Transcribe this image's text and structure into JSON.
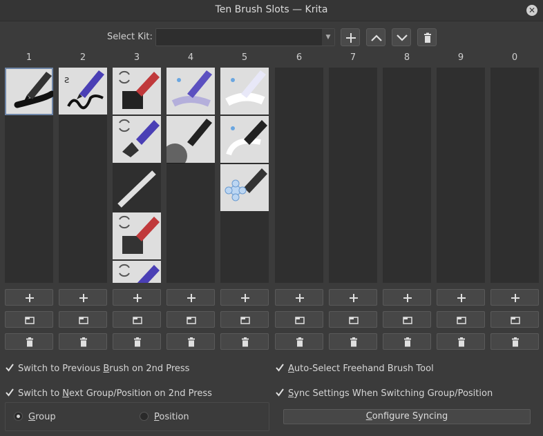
{
  "window": {
    "title": "Ten Brush Slots — Krita"
  },
  "kit": {
    "label": "Select Kit:",
    "value": ""
  },
  "columns": [
    {
      "number": "1",
      "tiles": [
        {
          "name": "pen-preset",
          "selected": true
        }
      ]
    },
    {
      "number": "2",
      "tiles": [
        {
          "name": "ink-pen-preset",
          "selected": false
        }
      ]
    },
    {
      "number": "3",
      "tiles": [
        {
          "name": "marker-preset",
          "selected": false
        },
        {
          "name": "fountain-pen-preset",
          "selected": false
        },
        {
          "name": "flat-stroke-preset",
          "selected": false
        },
        {
          "name": "marker-preset-2",
          "selected": false
        },
        {
          "name": "fountain-pen-preset-2",
          "selected": false
        }
      ]
    },
    {
      "number": "4",
      "tiles": [
        {
          "name": "airbrush-preset",
          "selected": false
        },
        {
          "name": "soft-pencil-preset",
          "selected": false
        }
      ]
    },
    {
      "number": "5",
      "tiles": [
        {
          "name": "blender-preset",
          "selected": false
        },
        {
          "name": "smudge-preset",
          "selected": false
        },
        {
          "name": "transform-pen-preset",
          "selected": false
        }
      ]
    },
    {
      "number": "6",
      "tiles": []
    },
    {
      "number": "7",
      "tiles": []
    },
    {
      "number": "8",
      "tiles": []
    },
    {
      "number": "9",
      "tiles": []
    },
    {
      "number": "0",
      "tiles": []
    }
  ],
  "options": {
    "prev_brush": {
      "label_a": "Switch to Previous ",
      "label_u": "B",
      "label_b": "rush on 2nd Press",
      "checked": true
    },
    "next_group": {
      "label_a": "Switch to ",
      "label_u": "N",
      "label_b": "ext Group/Position on 2nd Press",
      "checked": true
    },
    "auto_select": {
      "label_a": "",
      "label_u": "A",
      "label_b": "uto-Select Freehand Brush Tool",
      "checked": true
    },
    "sync_settings": {
      "label_a": "",
      "label_u": "S",
      "label_b": "ync Settings When Switching Group/Position",
      "checked": true
    },
    "radio_group": {
      "label_u": "G",
      "label_b": "roup",
      "selected": true
    },
    "radio_position": {
      "label_u": "P",
      "label_b": "osition",
      "selected": false
    },
    "configure": {
      "label_u": "C",
      "label_b": "onfigure Syncing"
    }
  },
  "colors": {
    "background": "#3b3b3b",
    "slot": "#2f2f2f",
    "selection": "#6f86a8"
  }
}
